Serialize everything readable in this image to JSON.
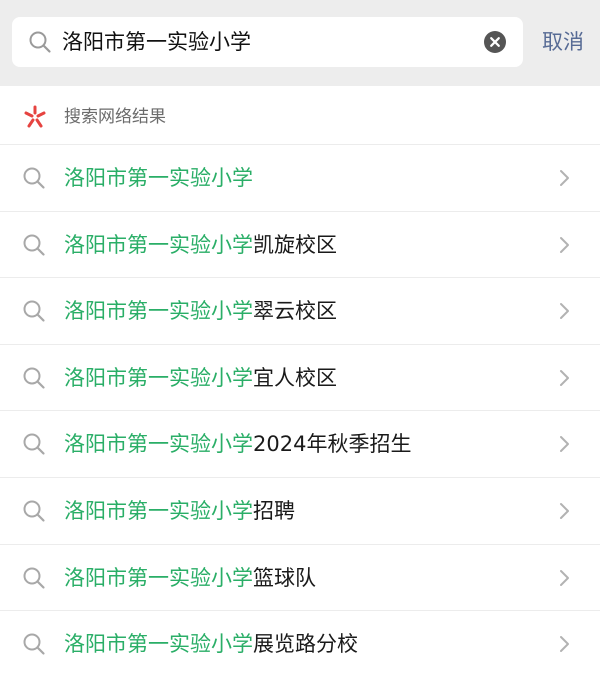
{
  "search": {
    "query": "洛阳市第一实验小学",
    "cancel_label": "取消"
  },
  "section": {
    "title": "搜索网络结果"
  },
  "colors": {
    "highlight": "#2aae67",
    "link": "#576b95",
    "logo": "#e64340"
  },
  "suggestions": [
    {
      "highlight": "洛阳市第一实验小学",
      "rest": ""
    },
    {
      "highlight": "洛阳市第一实验小学",
      "rest": "凯旋校区"
    },
    {
      "highlight": "洛阳市第一实验小学",
      "rest": "翠云校区"
    },
    {
      "highlight": "洛阳市第一实验小学",
      "rest": "宜人校区"
    },
    {
      "highlight": "洛阳市第一实验小学",
      "rest": "2024年秋季招生"
    },
    {
      "highlight": "洛阳市第一实验小学",
      "rest": "招聘"
    },
    {
      "highlight": "洛阳市第一实验小学",
      "rest": "篮球队"
    },
    {
      "highlight": "洛阳市第一实验小学",
      "rest": "展览路分校"
    }
  ]
}
